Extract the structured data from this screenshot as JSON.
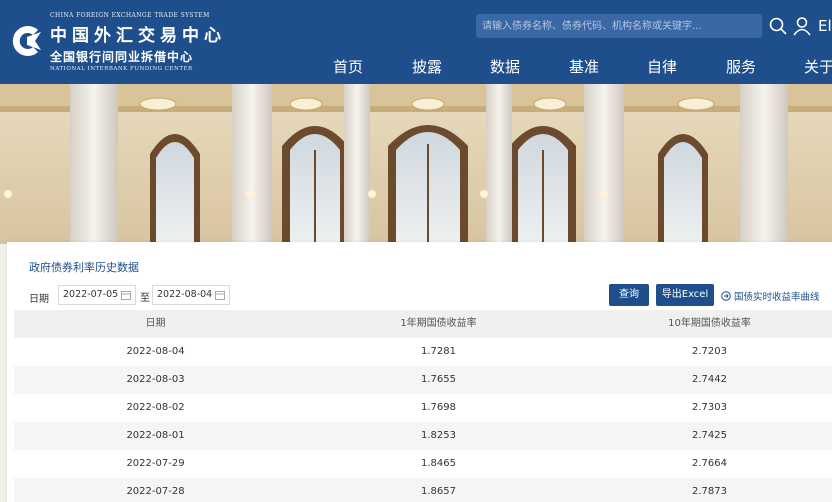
{
  "logo": {
    "en_top": "CHINA FOREIGN EXCHANGE TRADE SYSTEM",
    "cn_main": "中国外汇交易中心",
    "cn_sub": "全国银行间同业拆借中心",
    "en_bottom": "NATIONAL INTERBANK FUNDING CENTER"
  },
  "header": {
    "search_placeholder": "请输入债券名称、债券代码、机构名称或关键字...",
    "lang_label": "El",
    "nav": [
      "首页",
      "披露",
      "数据",
      "基准",
      "自律",
      "服务",
      "关于"
    ]
  },
  "panel": {
    "title": "政府债券利率历史数据",
    "filter_label": "日期",
    "start_date": "2022-07-05",
    "separator": "至",
    "end_date": "2022-08-04",
    "query_button": "查询",
    "export_button": "导出Excel",
    "curve_link": "国债实时收益率曲线"
  },
  "table": {
    "headers": [
      "日期",
      "1年期国债收益率",
      "10年期国债收益率"
    ],
    "rows": [
      [
        "2022-08-04",
        "1.7281",
        "2.7203"
      ],
      [
        "2022-08-03",
        "1.7655",
        "2.7442"
      ],
      [
        "2022-08-02",
        "1.7698",
        "2.7303"
      ],
      [
        "2022-08-01",
        "1.8253",
        "2.7425"
      ],
      [
        "2022-07-29",
        "1.8465",
        "2.7664"
      ],
      [
        "2022-07-28",
        "1.8657",
        "2.7873"
      ]
    ]
  },
  "colors": {
    "brand_blue": "#1f4e8c",
    "search_bg": "#3a68a6",
    "row_alt": "#f5f5f5"
  }
}
